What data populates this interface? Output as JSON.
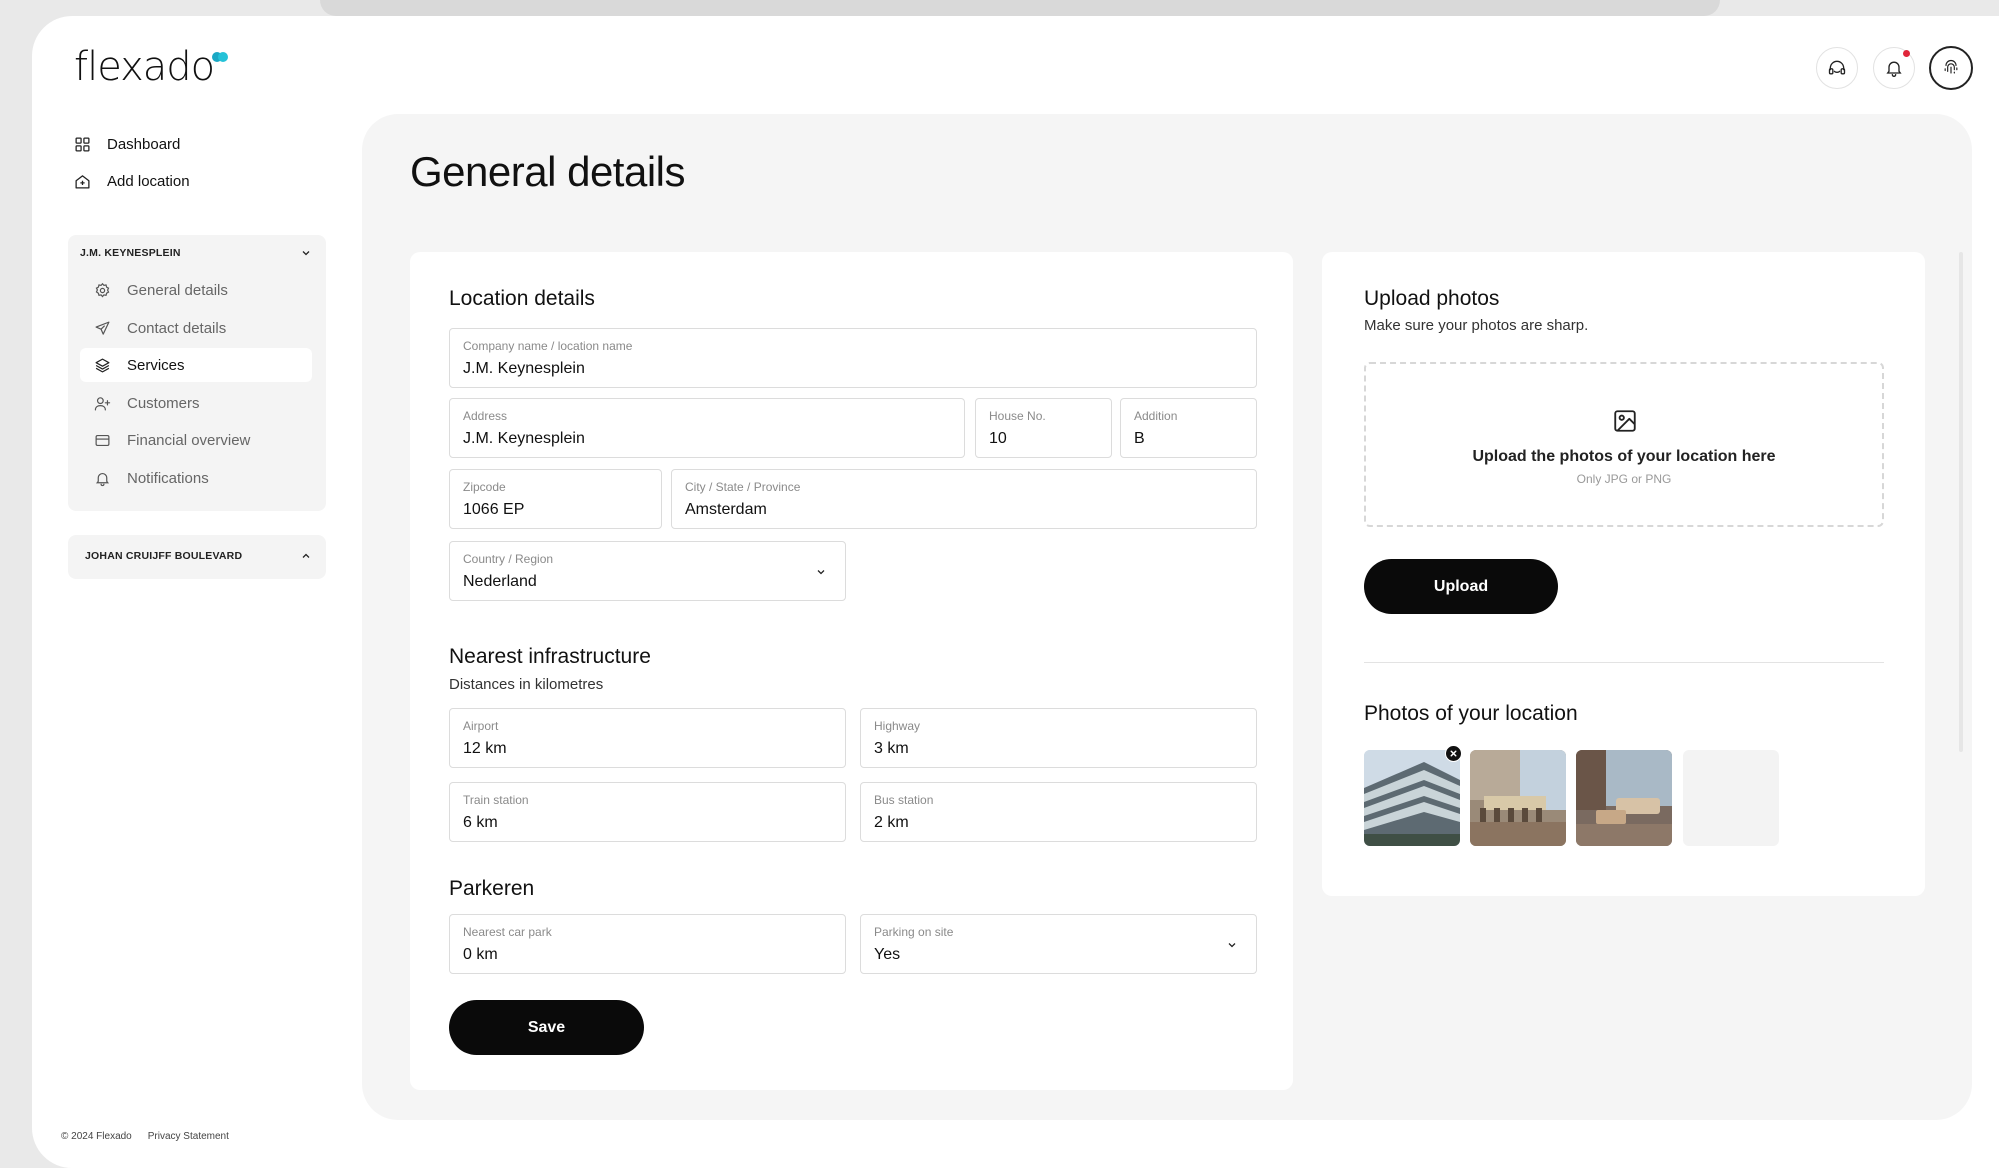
{
  "brand": {
    "logo_text": "flexado"
  },
  "header": {
    "support_icon": "headset-icon",
    "notifications_icon": "bell-icon",
    "profile_icon": "fingerprint-icon"
  },
  "sidebar": {
    "dashboard": "Dashboard",
    "add_location": "Add location",
    "groups": [
      {
        "title": "J.M. KEYNESPLEIN",
        "expanded": true,
        "items": [
          {
            "label": "General details",
            "icon": "gear-icon"
          },
          {
            "label": "Contact details",
            "icon": "send-icon"
          },
          {
            "label": "Services",
            "icon": "layers-icon",
            "active": true
          },
          {
            "label": "Customers",
            "icon": "user-plus-icon"
          },
          {
            "label": "Financial overview",
            "icon": "credit-card-icon"
          },
          {
            "label": "Notifications",
            "icon": "bell-icon"
          }
        ]
      },
      {
        "title": "JOHAN CRUIJFF BOULEVARD",
        "expanded": false
      }
    ]
  },
  "footer": {
    "copyright": "© 2024 Flexado",
    "privacy": "Privacy Statement"
  },
  "page": {
    "title": "General details"
  },
  "location": {
    "title": "Location details",
    "company": {
      "label": "Company name / location name",
      "value": "J.M. Keynesplein"
    },
    "address": {
      "label": "Address",
      "value": "J.M. Keynesplein"
    },
    "house_no": {
      "label": "House No.",
      "value": "10"
    },
    "addition": {
      "label": "Addition",
      "value": "B"
    },
    "zipcode": {
      "label": "Zipcode",
      "value": "1066 EP"
    },
    "city": {
      "label": "City / State / Province",
      "value": "Amsterdam"
    },
    "country": {
      "label": "Country / Region",
      "value": "Nederland"
    }
  },
  "infrastructure": {
    "title": "Nearest infrastructure",
    "subtitle": "Distances in kilometres",
    "airport": {
      "label": "Airport",
      "value": "12 km"
    },
    "highway": {
      "label": "Highway",
      "value": "3 km"
    },
    "train": {
      "label": "Train station",
      "value": "6 km"
    },
    "bus": {
      "label": "Bus station",
      "value": "2 km"
    }
  },
  "parking": {
    "title": "Parkeren",
    "car_park": {
      "label": "Nearest car park",
      "value": "0 km"
    },
    "on_site": {
      "label": "Parking on site",
      "value": "Yes"
    }
  },
  "save_label": "Save",
  "upload": {
    "title": "Upload photos",
    "subtitle": "Make sure your photos are sharp.",
    "drop_main": "Upload the photos of your location here",
    "drop_sub": "Only JPG or PNG",
    "button": "Upload"
  },
  "photos": {
    "title": "Photos of your location"
  }
}
